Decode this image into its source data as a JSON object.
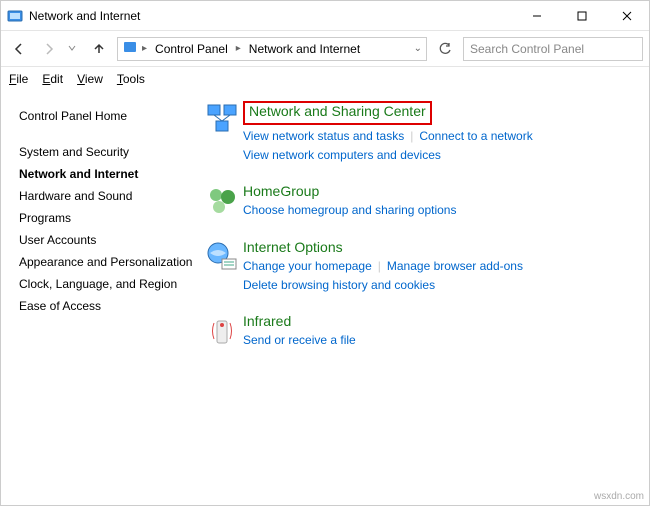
{
  "window": {
    "title": "Network and Internet"
  },
  "breadcrumb": {
    "seg1": "Control Panel",
    "seg2": "Network and Internet"
  },
  "search": {
    "placeholder": "Search Control Panel"
  },
  "menu": {
    "file": "File",
    "edit": "Edit",
    "view": "View",
    "tools": "Tools"
  },
  "sidebar": {
    "home": "Control Panel Home",
    "items": [
      "System and Security",
      "Network and Internet",
      "Hardware and Sound",
      "Programs",
      "User Accounts",
      "Appearance and Personalization",
      "Clock, Language, and Region",
      "Ease of Access"
    ]
  },
  "categories": [
    {
      "title": "Network and Sharing Center",
      "links": [
        "View network status and tasks",
        "Connect to a network",
        "View network computers and devices"
      ]
    },
    {
      "title": "HomeGroup",
      "links": [
        "Choose homegroup and sharing options"
      ]
    },
    {
      "title": "Internet Options",
      "links": [
        "Change your homepage",
        "Manage browser add-ons",
        "Delete browsing history and cookies"
      ]
    },
    {
      "title": "Infrared",
      "links": [
        "Send or receive a file"
      ]
    }
  ],
  "watermark": "wsxdn.com"
}
